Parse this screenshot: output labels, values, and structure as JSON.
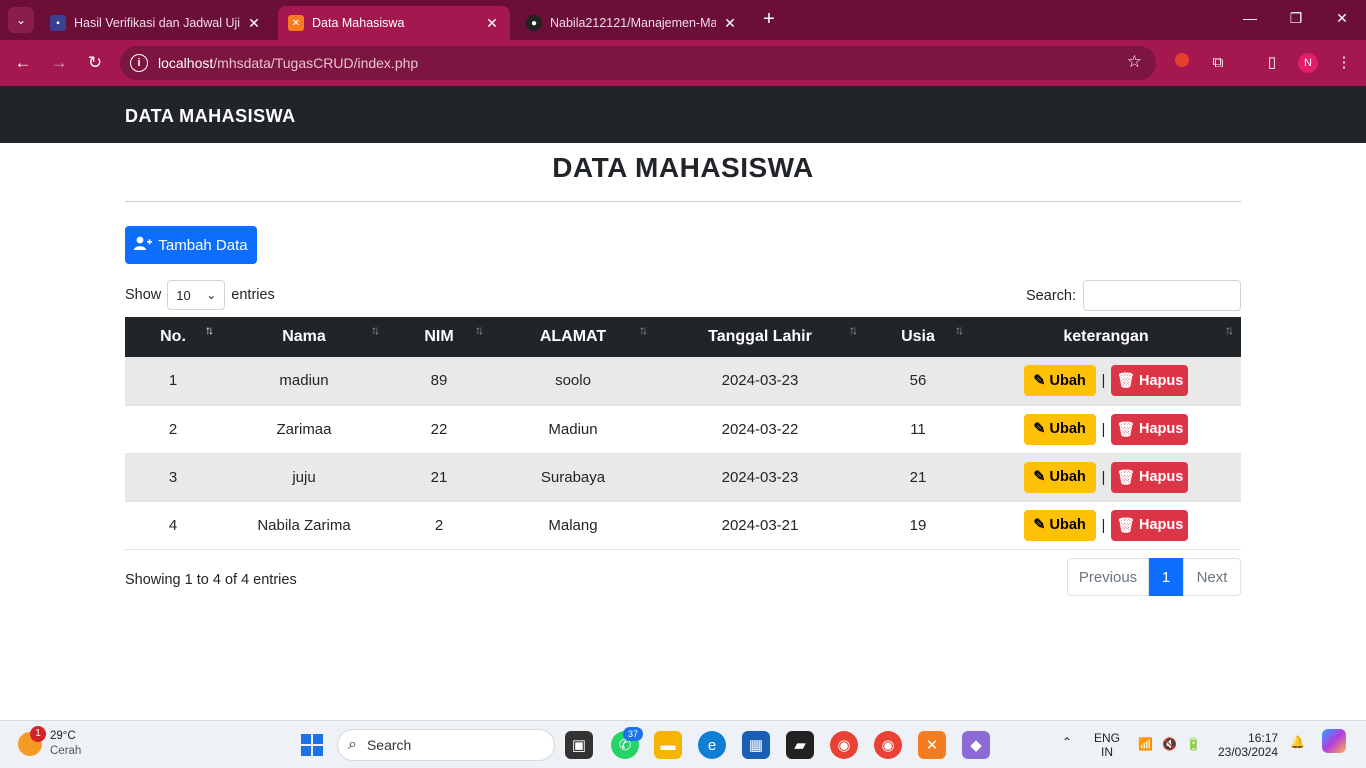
{
  "browser": {
    "tabs": [
      {
        "title": "Hasil Verifikasi dan Jadwal Ujian",
        "active": false
      },
      {
        "title": "Data Mahasiswa",
        "active": true
      },
      {
        "title": "Nabila212121/Manajemen-Mah",
        "active": false
      }
    ],
    "url_host": "localhost",
    "url_path": "/mhsdata/TugasCRUD/index.php",
    "profile_initial": "N"
  },
  "navbar": {
    "brand": "DATA MAHASISWA"
  },
  "page": {
    "title": "DATA MAHASISWA",
    "add_button": "Tambah Data",
    "show_label": "Show",
    "entries_value": "10",
    "entries_label": "entries",
    "search_label": "Search:"
  },
  "table": {
    "headers": [
      "No.",
      "Nama",
      "NIM",
      "ALAMAT",
      "Tanggal Lahir",
      "Usia",
      "keterangan"
    ],
    "rows": [
      {
        "no": "1",
        "nama": "madiun",
        "nim": "89",
        "alamat": "soolo",
        "tanggal": "2024-03-23",
        "usia": "56"
      },
      {
        "no": "2",
        "nama": "Zarimaa",
        "nim": "22",
        "alamat": "Madiun",
        "tanggal": "2024-03-22",
        "usia": "11"
      },
      {
        "no": "3",
        "nama": "juju",
        "nim": "21",
        "alamat": "Surabaya",
        "tanggal": "2024-03-23",
        "usia": "21"
      },
      {
        "no": "4",
        "nama": "Nabila Zarima",
        "nim": "2",
        "alamat": "Malang",
        "tanggal": "2024-03-21",
        "usia": "19"
      }
    ],
    "edit_label": "Ubah",
    "delete_label": "Hapus",
    "separator": "|"
  },
  "footer": {
    "info": "Showing 1 to 4 of 4 entries",
    "prev": "Previous",
    "page": "1",
    "next": "Next"
  },
  "taskbar": {
    "weather_temp": "29°C",
    "weather_desc": "Cerah",
    "weather_badge": "1",
    "search_placeholder": "Search",
    "whatsapp_badge": "37",
    "lang_top": "ENG",
    "lang_bottom": "IN",
    "time": "16:17",
    "date": "23/03/2024"
  },
  "colors": {
    "browser_accent": "#a4174f",
    "primary": "#0d6efd",
    "warning": "#ffc107",
    "danger": "#dc3545",
    "dark": "#212529"
  }
}
